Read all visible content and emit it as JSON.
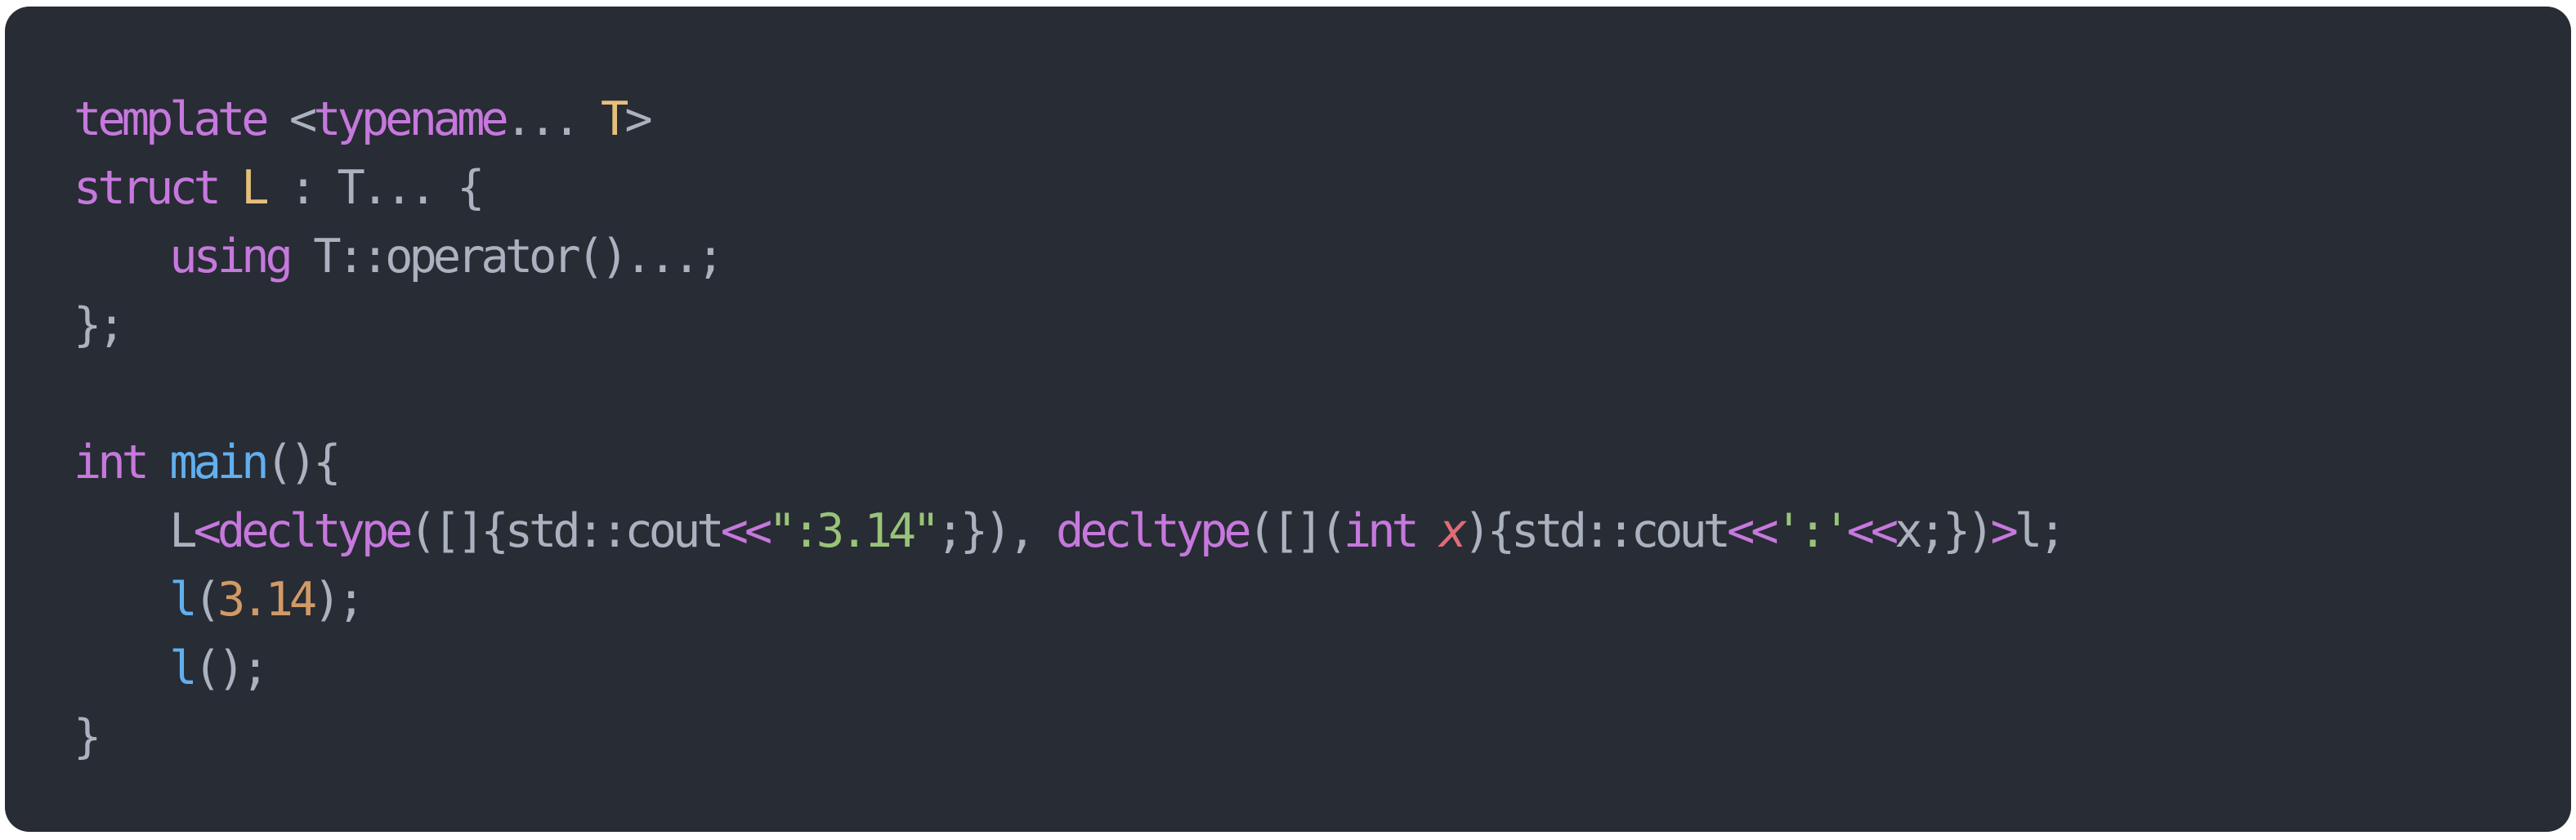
{
  "code": {
    "language": "cpp",
    "lines": [
      [
        {
          "t": "template",
          "c": "kw"
        },
        {
          "t": " <",
          "c": "pun"
        },
        {
          "t": "typename",
          "c": "kw"
        },
        {
          "t": "... ",
          "c": "pun"
        },
        {
          "t": "T",
          "c": "ty"
        },
        {
          "t": ">",
          "c": "pun"
        }
      ],
      [
        {
          "t": "struct",
          "c": "kw"
        },
        {
          "t": " ",
          "c": "pun"
        },
        {
          "t": "L",
          "c": "ty"
        },
        {
          "t": " : T... {",
          "c": "pun"
        }
      ],
      [
        {
          "t": "    ",
          "c": "pun"
        },
        {
          "t": "using",
          "c": "kw"
        },
        {
          "t": " T::operator()...;",
          "c": "pun"
        }
      ],
      [
        {
          "t": "};",
          "c": "pun"
        }
      ],
      [],
      [
        {
          "t": "int",
          "c": "kw"
        },
        {
          "t": " ",
          "c": "pun"
        },
        {
          "t": "main",
          "c": "fn"
        },
        {
          "t": "(){",
          "c": "pun"
        }
      ],
      [
        {
          "t": "    L",
          "c": "pun"
        },
        {
          "t": "<",
          "c": "kw"
        },
        {
          "t": "decltype",
          "c": "kw"
        },
        {
          "t": "([]{std::cout",
          "c": "pun"
        },
        {
          "t": "<<",
          "c": "kw"
        },
        {
          "t": "\":3.14\"",
          "c": "str"
        },
        {
          "t": ";}), ",
          "c": "pun"
        },
        {
          "t": "decltype",
          "c": "kw"
        },
        {
          "t": "([](",
          "c": "pun"
        },
        {
          "t": "int",
          "c": "kw"
        },
        {
          "t": " ",
          "c": "pun"
        },
        {
          "t": "x",
          "c": "prm"
        },
        {
          "t": "){std::cout",
          "c": "pun"
        },
        {
          "t": "<<",
          "c": "kw"
        },
        {
          "t": "':'",
          "c": "str"
        },
        {
          "t": "<<",
          "c": "kw"
        },
        {
          "t": "x;})",
          "c": "pun"
        },
        {
          "t": ">",
          "c": "kw"
        },
        {
          "t": "l;",
          "c": "pun"
        }
      ],
      [
        {
          "t": "    ",
          "c": "pun"
        },
        {
          "t": "l",
          "c": "fn"
        },
        {
          "t": "(",
          "c": "pun"
        },
        {
          "t": "3.14",
          "c": "num"
        },
        {
          "t": ");",
          "c": "pun"
        }
      ],
      [
        {
          "t": "    ",
          "c": "pun"
        },
        {
          "t": "l",
          "c": "fn"
        },
        {
          "t": "();",
          "c": "pun"
        }
      ],
      [
        {
          "t": "}",
          "c": "pun"
        }
      ]
    ]
  },
  "theme": {
    "background": "#282c34",
    "page": "#ffffff",
    "text": "#abb2bf",
    "keyword": "#c678dd",
    "type": "#e5c07b",
    "function": "#61afef",
    "string": "#98c379",
    "number": "#d19a66",
    "parameter": "#e06c75"
  }
}
